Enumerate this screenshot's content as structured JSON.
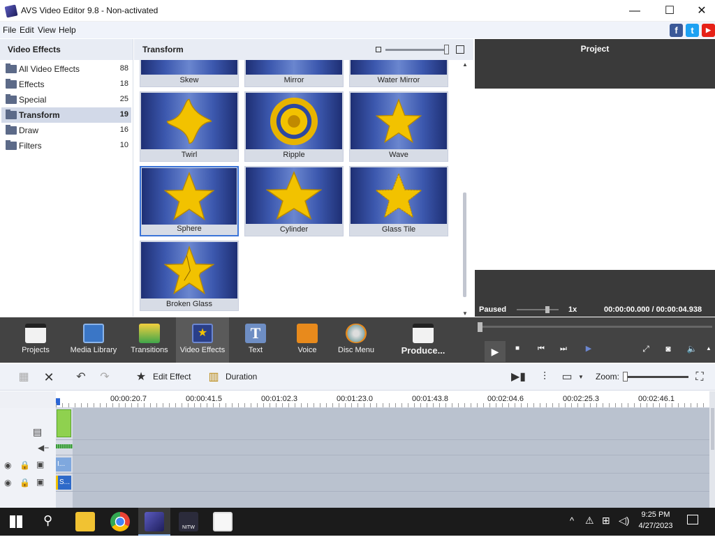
{
  "window": {
    "title": "AVS Video Editor 9.8 - Non-activated",
    "minimize": "—",
    "maximize": "☐",
    "close": "✕"
  },
  "menu": {
    "items": [
      "File",
      "Edit",
      "View",
      "Help"
    ],
    "social": [
      "f",
      "t",
      "▶"
    ],
    "social_colors": [
      "#3b5998",
      "#1da1f2",
      "#e62117"
    ]
  },
  "left_panel": {
    "title": "Video Effects",
    "categories": [
      {
        "label": "All Video Effects",
        "count": "88"
      },
      {
        "label": "Effects",
        "count": "18"
      },
      {
        "label": "Special",
        "count": "25"
      },
      {
        "label": "Transform",
        "count": "19",
        "selected": true
      },
      {
        "label": "Draw",
        "count": "16"
      },
      {
        "label": "Filters",
        "count": "10"
      }
    ]
  },
  "mid_panel": {
    "title": "Transform",
    "effects": [
      "Skew",
      "Mirror",
      "Water Mirror",
      "Twirl",
      "Ripple",
      "Wave",
      "Sphere",
      "Cylinder",
      "Glass Tile",
      "Broken Glass"
    ],
    "selected": "Sphere"
  },
  "right_panel": {
    "title": "Project",
    "status": "Paused",
    "speed": "1x",
    "time_current": "00:00:00.000",
    "time_separator": "/",
    "time_total": "00:00:04.938"
  },
  "toolbar": {
    "items": [
      {
        "label": "Projects",
        "icon": "clapperboard-icon"
      },
      {
        "label": "Media Library",
        "icon": "film-icon"
      },
      {
        "label": "Transitions",
        "icon": "transition-icon"
      },
      {
        "label": "Video Effects",
        "icon": "star-effect-icon",
        "active": true
      },
      {
        "label": "Text",
        "icon": "text-icon"
      },
      {
        "label": "Voice",
        "icon": "microphone-icon"
      },
      {
        "label": "Disc Menu",
        "icon": "disc-icon"
      },
      {
        "label": "Produce...",
        "icon": "produce-icon"
      }
    ]
  },
  "timeline_toolbar": {
    "edit_effect": "Edit Effect",
    "duration": "Duration",
    "zoom_label": "Zoom:"
  },
  "timeline": {
    "ticks": [
      "00:00:20.7",
      "00:00:41.5",
      "00:01:02.3",
      "00:01:23.0",
      "00:01:43.8",
      "00:02:04.6",
      "00:02:25.3",
      "00:02:46.1"
    ],
    "clip_text_1": "I...",
    "clip_text_2": "S..."
  },
  "taskbar": {
    "time": "9:25 PM",
    "date": "4/27/2023",
    "apps": [
      "windows-start-icon",
      "search-icon",
      "file-explorer-icon",
      "chrome-icon",
      "avs-video-editor-icon",
      "nitw-icon",
      "photos-icon"
    ],
    "nitw_label": "NITW"
  }
}
